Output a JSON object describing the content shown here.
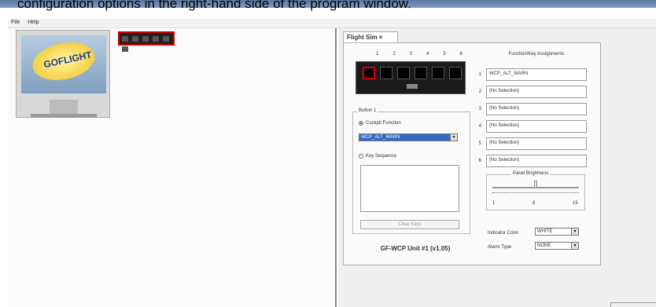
{
  "caption": {
    "text": "configuration options in the right-hand side of the program window."
  },
  "menu": {
    "file": "File",
    "help": "Help"
  },
  "device": {
    "logo_text": "GOFLIGHT"
  },
  "tab": {
    "label": "Flight Sim ×"
  },
  "hardware": {
    "button_numbers": [
      "1",
      "2",
      "3",
      "4",
      "5",
      "6"
    ],
    "selected_button": 1
  },
  "button_group": {
    "label": "Button 1",
    "cockpit_label": "Cockpit Function",
    "cockpit_value": "WCP_ALT_WARN",
    "key_label": "Key Sequence",
    "clear_label": "Clear Keys"
  },
  "unit_label": "GF-WCP Unit #1 (v1.05)",
  "assignments": {
    "title": "Function/Key Assignments",
    "items": [
      {
        "num": "1",
        "value": "WCP_ALT_WARN"
      },
      {
        "num": "2",
        "value": "(No Selection)"
      },
      {
        "num": "3",
        "value": "(No Selection)"
      },
      {
        "num": "4",
        "value": "(No Selection)"
      },
      {
        "num": "5",
        "value": "(No Selection)"
      },
      {
        "num": "6",
        "value": "(No Selection)"
      }
    ]
  },
  "brightness": {
    "label": "Panel Brightness",
    "min": "1",
    "mid": "8",
    "max": "15",
    "value": 8
  },
  "indicator": {
    "label": "Indicator Color",
    "value": "WHITE"
  },
  "alarm": {
    "label": "Alarm Type",
    "value": "NONE"
  },
  "colors": {
    "selected_border": "#d00000",
    "selection_blue": "#316ac5",
    "title_bar": "#3d5f8f"
  }
}
